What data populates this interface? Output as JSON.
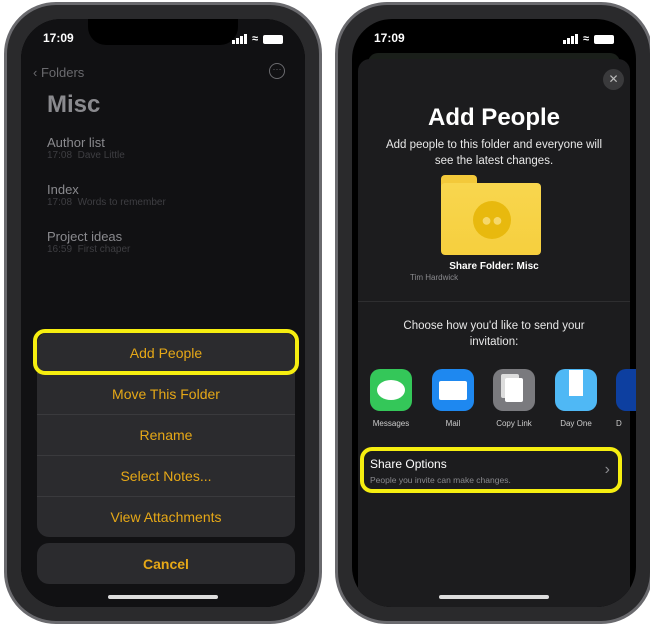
{
  "left": {
    "status_time": "17:09",
    "back_label": "Folders",
    "title": "Misc",
    "notes": [
      {
        "title": "Author list",
        "time": "17:08",
        "preview": "Dave Little"
      },
      {
        "title": "Index",
        "time": "17:08",
        "preview": "Words to remember"
      },
      {
        "title": "Project ideas",
        "time": "16:59",
        "preview": "First chaper"
      }
    ],
    "actions": [
      "Add People",
      "Move This Folder",
      "Rename",
      "Select Notes...",
      "View Attachments"
    ],
    "cancel_label": "Cancel"
  },
  "right": {
    "status_time": "17:09",
    "title": "Add People",
    "subtitle_line1": "Add people to this folder and everyone will",
    "subtitle_line2": "see the latest changes.",
    "folder_name": "Share Folder: Misc",
    "owner": "Tim Hardwick",
    "choose_line1": "Choose how you'd like to send your",
    "choose_line2": "invitation:",
    "apps": [
      {
        "label": "Messages",
        "icon": "messages-icon",
        "color": "#34c759"
      },
      {
        "label": "Mail",
        "icon": "mail-icon",
        "color": "#1e88f0"
      },
      {
        "label": "Copy Link",
        "icon": "copy-link-icon",
        "color": "#7a7a7e"
      },
      {
        "label": "Day One",
        "icon": "day-one-icon",
        "color": "#4fb8f5"
      },
      {
        "label": "D",
        "icon": "dropbox-icon",
        "color": "#0d3fa0"
      }
    ],
    "share_options_title": "Share Options",
    "share_options_subtitle": "People you invite can make changes."
  },
  "colors": {
    "highlight": "#f6ee10",
    "accent": "#e6a817",
    "folder": "#f8d64e"
  }
}
